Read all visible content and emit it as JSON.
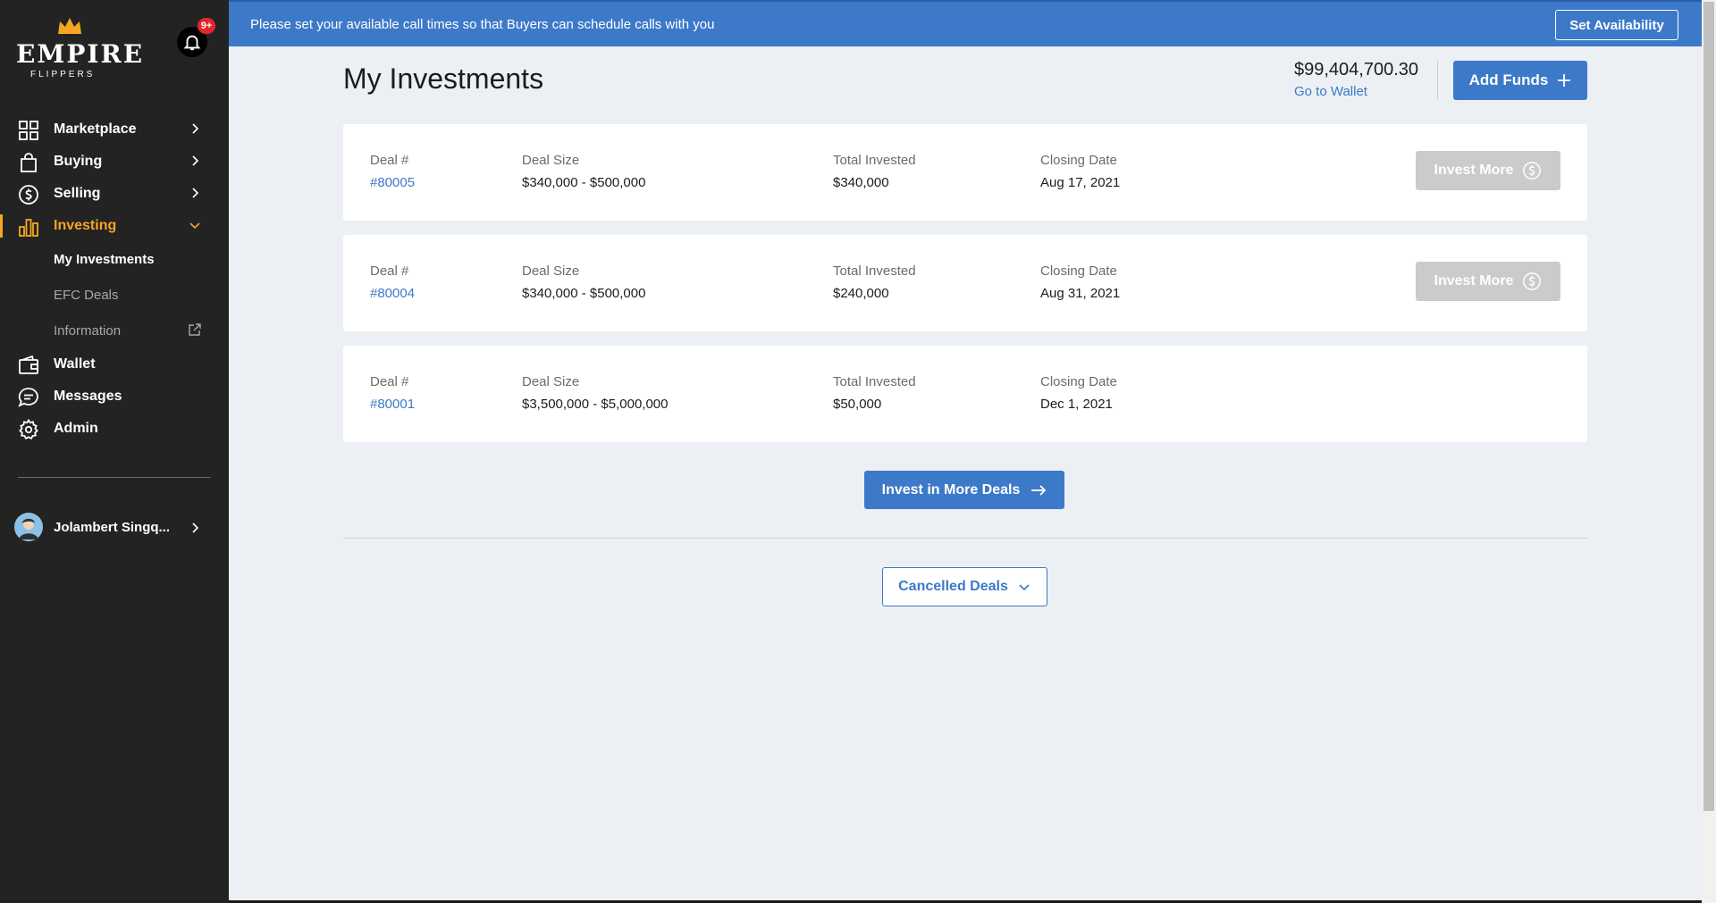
{
  "logo": {
    "word": "EMPIRE",
    "sub": "FLIPPERS"
  },
  "notifications": {
    "badge": "9+"
  },
  "nav": {
    "marketplace": "Marketplace",
    "buying": "Buying",
    "selling": "Selling",
    "investing": "Investing",
    "sub": {
      "my_investments": "My Investments",
      "efc_deals": "EFC Deals",
      "information": "Information"
    },
    "wallet": "Wallet",
    "messages": "Messages",
    "admin": "Admin"
  },
  "user": {
    "name": "Jolambert Singq..."
  },
  "banner": {
    "message": "Please set your available call times so that Buyers can schedule calls with you",
    "button": "Set Availability"
  },
  "header": {
    "title": "My Investments",
    "balance": "$99,404,700.30",
    "wallet_link": "Go to Wallet",
    "add_funds": "Add Funds"
  },
  "columns": {
    "deal": "Deal #",
    "size": "Deal Size",
    "invested": "Total Invested",
    "closing": "Closing Date"
  },
  "deals": [
    {
      "id": "#80005",
      "size": "$340,000 - $500,000",
      "invested": "$340,000",
      "closing": "Aug 17, 2021",
      "action": "Invest More"
    },
    {
      "id": "#80004",
      "size": "$340,000 - $500,000",
      "invested": "$240,000",
      "closing": "Aug 31, 2021",
      "action": "Invest More"
    },
    {
      "id": "#80001",
      "size": "$3,500,000 - $5,000,000",
      "invested": "$50,000",
      "closing": "Dec 1, 2021"
    }
  ],
  "actions": {
    "more_deals": "Invest in More Deals",
    "cancelled": "Cancelled Deals"
  },
  "colors": {
    "sidebar": "#232323",
    "accent": "#f5a623",
    "primary": "#3d79c9",
    "disabled": "#c9cbcd",
    "background": "#ecf0f4"
  }
}
